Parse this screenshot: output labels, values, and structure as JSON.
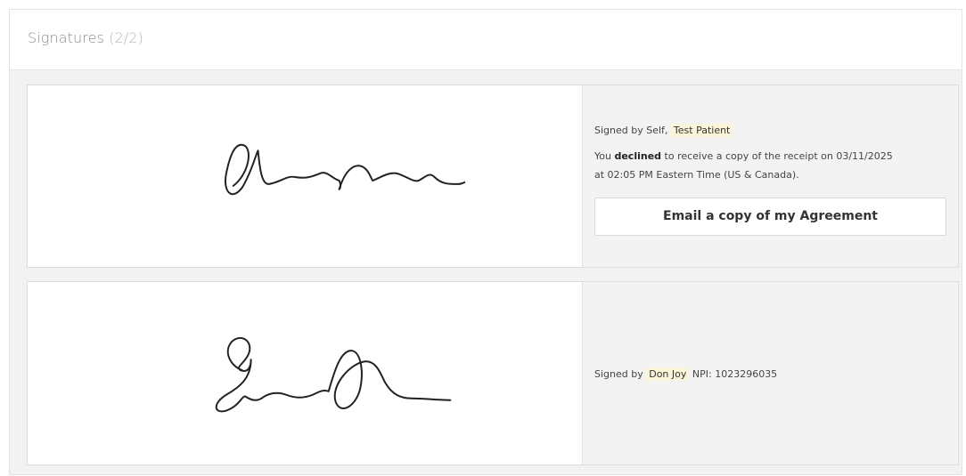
{
  "panel": {
    "title": "Signatures",
    "count": "(2/2)"
  },
  "signatures": [
    {
      "signed_by_prefix": "Signed by Self,",
      "signer_name": "Test Patient",
      "status_you": "You",
      "status_word": "declined",
      "status_rest_line1": "to receive a copy of the receipt on 03/11/2025",
      "status_line2": "at 02:05 PM Eastern Time (US & Canada).",
      "email_button_label": "Email a copy of my Agreement"
    },
    {
      "signed_by_prefix": "Signed by",
      "signer_name": "Don Joy",
      "npi_text": "NPI: 1023296035"
    }
  ]
}
